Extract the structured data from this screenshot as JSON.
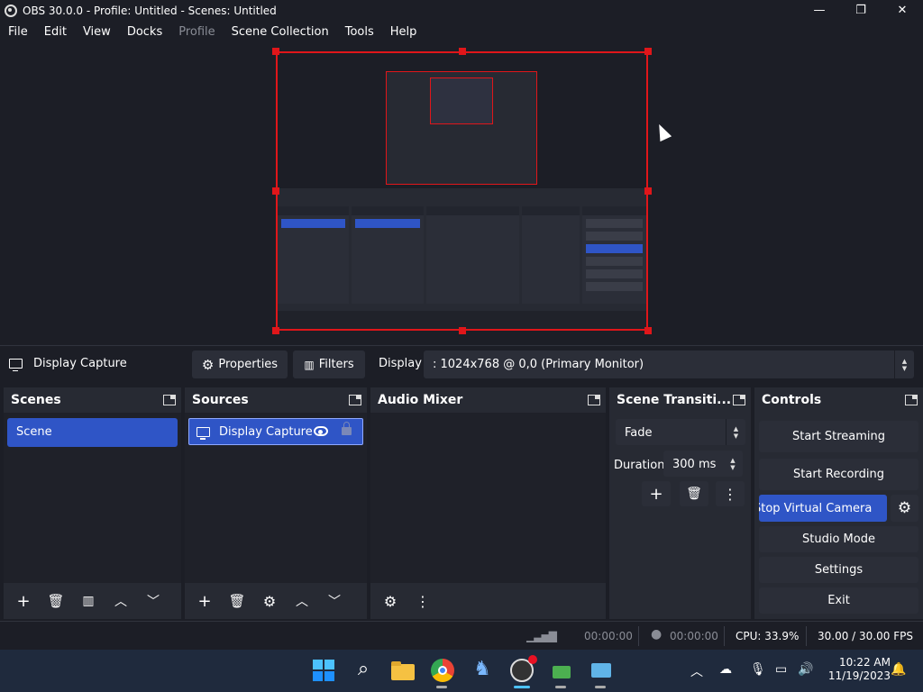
{
  "window": {
    "title": "OBS 30.0.0 - Profile: Untitled - Scenes: Untitled",
    "minimize": "—",
    "maximize": "❐",
    "close": "✕"
  },
  "menu": {
    "items": [
      "File",
      "Edit",
      "View",
      "Docks",
      "Profile",
      "Scene Collection",
      "Tools",
      "Help"
    ]
  },
  "source_toolbar": {
    "source_name": "Display Capture",
    "properties_label": "Properties",
    "filters_label": "Filters",
    "display_label": "Display",
    "display_value": ": 1024x768 @ 0,0 (Primary Monitor)"
  },
  "scenes": {
    "title": "Scenes",
    "items": [
      "Scene"
    ]
  },
  "sources": {
    "title": "Sources",
    "items": [
      "Display Capture"
    ]
  },
  "audio_mixer": {
    "title": "Audio Mixer"
  },
  "transitions": {
    "title": "Scene Transiti...",
    "selected": "Fade",
    "duration_label": "Duration",
    "duration_value": "300 ms"
  },
  "controls": {
    "title": "Controls",
    "start_streaming": "Start Streaming",
    "start_recording": "Start Recording",
    "stop_virtual_camera": "Stop Virtual Camera",
    "studio_mode": "Studio Mode",
    "settings": "Settings",
    "exit": "Exit"
  },
  "status": {
    "stream_time": "00:00:00",
    "record_time": "00:00:00",
    "cpu": "CPU: 33.9%",
    "fps": "30.00 / 30.00 FPS"
  },
  "taskbar": {
    "time": "10:22 AM",
    "date": "11/19/2023"
  },
  "colors": {
    "accent": "#2f55c6",
    "selection_border": "#e0161a",
    "dock_bg": "#272a33",
    "app_bg": "#1c1e26"
  }
}
